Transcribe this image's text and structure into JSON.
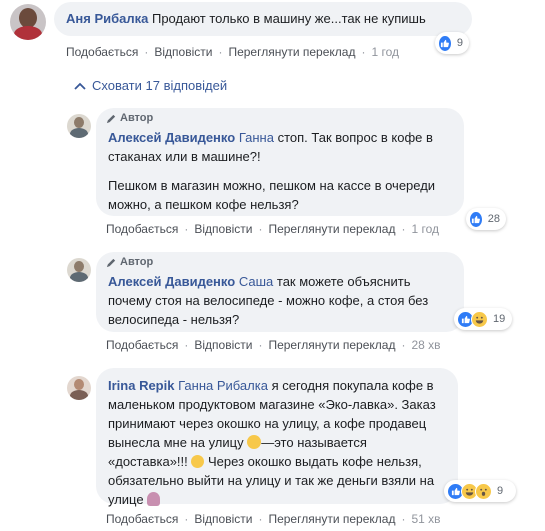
{
  "top_comment": {
    "author": "Аня Рибалка",
    "text": "Продают только в машину же...так не купишь",
    "actions": [
      "Подобається",
      "Відповісти",
      "Переглянути переклад"
    ],
    "time": "1 год",
    "reaction_count": "9"
  },
  "hide_replies": "Сховати 17 відповідей",
  "replies": [
    {
      "badge": "Автор",
      "author": "Алексей Давиденко",
      "mention": "Ганна",
      "text1": "стоп. Так вопрос в кофе в стаканах или в машине?!",
      "text2": "Пешком в магазин можно, пешком на кассе в очереди можно, а пешком кофе нельзя?",
      "actions": [
        "Подобається",
        "Відповісти",
        "Переглянути переклад"
      ],
      "time": "1 год",
      "reaction_count": "28"
    },
    {
      "badge": "Автор",
      "author": "Алексей Давиденко",
      "mention": "Саша",
      "text1": "так можете объяснить почему стоя на велосипеде - можно кофе, а стоя без велосипеда - нельзя?",
      "actions": [
        "Подобається",
        "Відповісти",
        "Переглянути переклад"
      ],
      "time": "28 хв",
      "reaction_count": "19"
    },
    {
      "author": "Irina Repik",
      "mention": "Ганна Рибалка",
      "text1": "я сегодня покупала кофе в маленьком продуктовом магазине «Эко-лавка». Заказ принимают через окошко на улицу, а кофе продавец вынесла мне на улицу",
      "text2": "—это называется «доставка»!!!",
      "text3": "Через окошко выдать кофе нельзя, обязательно выйти на улицу и так же деньги взяли на улице",
      "actions": [
        "Подобається",
        "Відповісти",
        "Переглянути переклад"
      ],
      "time": "51 хв",
      "reaction_count": "9"
    }
  ],
  "colors": {
    "link": "#385898",
    "bubble": "#f0f2f5",
    "like": "#2f7cf6"
  }
}
